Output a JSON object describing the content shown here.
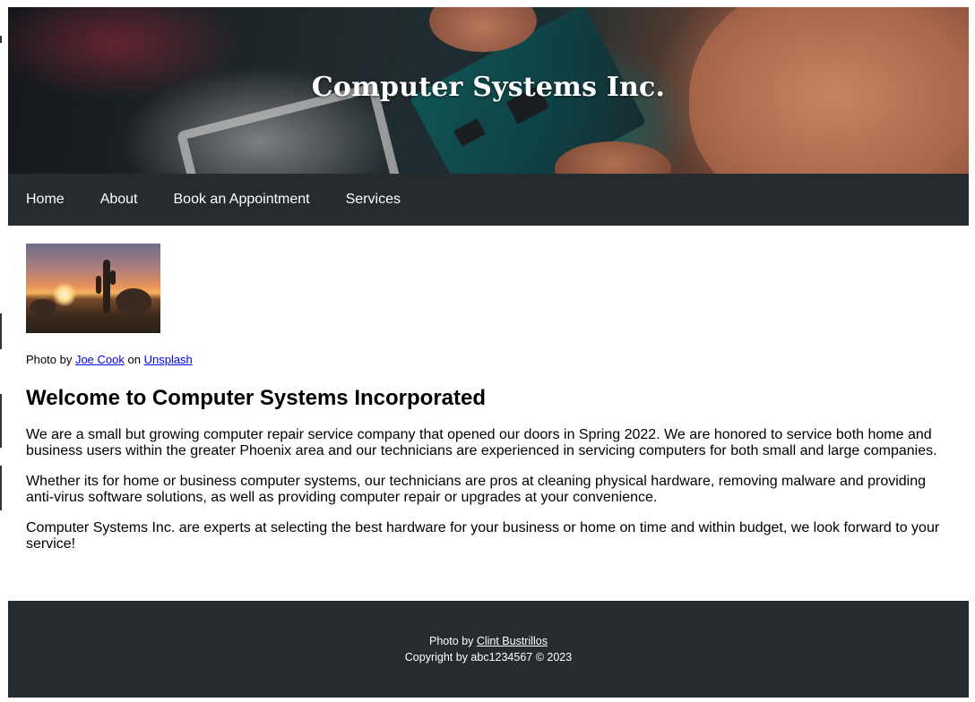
{
  "header": {
    "title": "Computer Systems Inc."
  },
  "nav": {
    "items": [
      {
        "label": "Home"
      },
      {
        "label": "About"
      },
      {
        "label": "Book an Appointment"
      },
      {
        "label": "Services"
      }
    ]
  },
  "main": {
    "photo_caption": {
      "prefix": "Photo by",
      "author": "Joe Cook",
      "middle": "on",
      "source": "Unsplash"
    },
    "heading": "Welcome to Computer Systems Incorporated",
    "paragraphs": [
      "We are a small but growing computer repair service company that opened our doors in Spring 2022. We are honored to service both home and business users within the greater Phoenix area and our technicians are experienced in servicing computers for both small and large companies.",
      "Whether its for home or business computer systems, our technicians are pros at cleaning physical hardware, removing malware and providing anti-virus software solutions, as well as providing computer repair or upgrades at your convenience.",
      "Computer Systems Inc. are experts at selecting the best hardware for your business or home on time and within budget, we look forward to your service!"
    ]
  },
  "footer": {
    "photo_prefix": "Photo by",
    "photo_author": "Clint Bustrillos",
    "copyright": "Copyright by abc1234567 © 2023"
  },
  "colors": {
    "nav_bg": "#252b2e",
    "footer_bg": "#252b2e",
    "link": "#0000ee"
  }
}
